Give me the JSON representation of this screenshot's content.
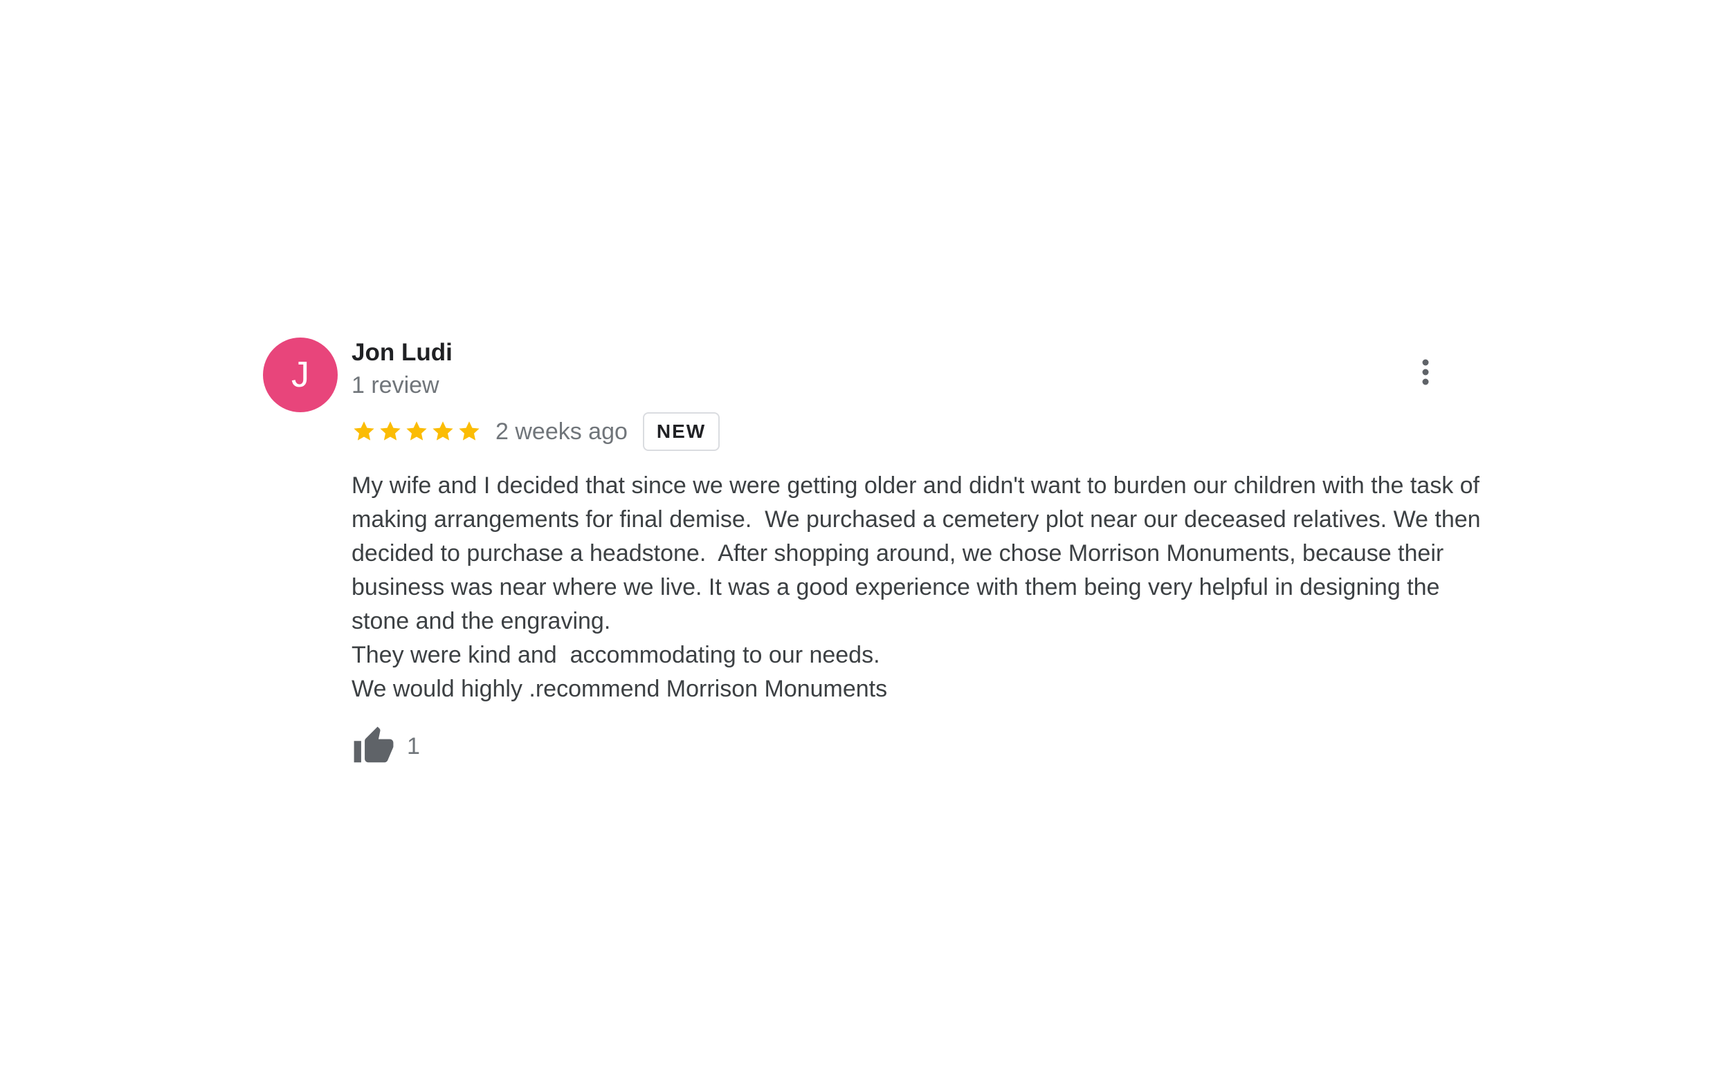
{
  "review": {
    "avatar_initial": "J",
    "avatar_color": "#e8457b",
    "author_name": "Jon Ludi",
    "review_count": "1 review",
    "rating": 5,
    "rating_max": 5,
    "star_color": "#fbbc04",
    "time_ago": "2 weeks ago",
    "badge": "NEW",
    "text": "My wife and I decided that since we were getting older and didn't want to burden our children with the task of making arrangements for final demise.  We purchased a cemetery plot near our deceased relatives. We then decided to purchase a headstone.  After shopping around, we chose Morrison Monuments, because their business was near where we live. It was a good experience with them being very helpful in designing the stone and the engraving.\nThey were kind and  accommodating to our needs.\nWe would highly .recommend Morrison Monuments",
    "like_count": "1",
    "icons": {
      "more": "more-vert-icon",
      "like": "thumb-up-icon",
      "star": "star-icon"
    }
  }
}
